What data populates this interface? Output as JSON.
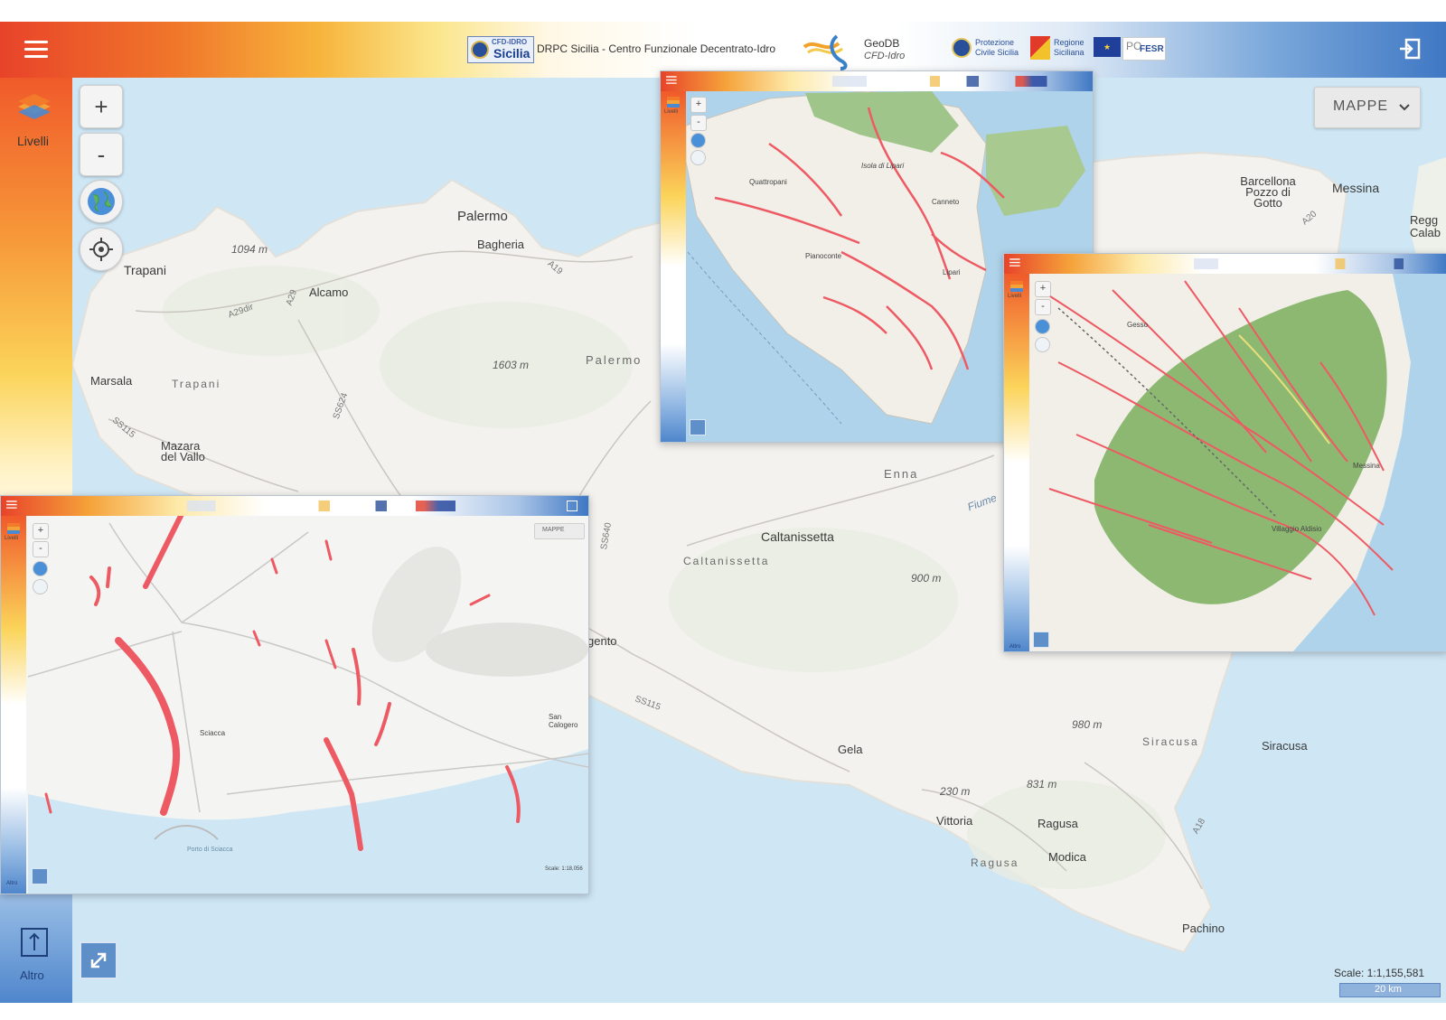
{
  "header": {
    "logo_cfd_top": "CFD-IDRO",
    "logo_cfd_bottom": "Sicilia",
    "title": "DRPC Sicilia - Centro Funzionale Decentrato-Idro",
    "geodb_title": "GeoDB",
    "geodb_sub": "CFD-Idro",
    "protezione_line1": "Protezione",
    "protezione_line2": "Civile Sicilia",
    "regione_line1": "Regione",
    "regione_line2": "Siciliana",
    "fesr_label": "FESR",
    "po_label": "PO"
  },
  "sidebar": {
    "layers_label": "Livelli",
    "altro_label": "Altro"
  },
  "controls": {
    "zoom_in": "+",
    "zoom_out": "-"
  },
  "maps_button": {
    "label": "MAPPE"
  },
  "scale": {
    "text": "Scale: 1:1,155,581",
    "bar_label": "20 km"
  },
  "map_labels": {
    "palermo": "Palermo",
    "palermo_province": "Palermo",
    "bagheria": "Bagheria",
    "trapani": "Trapani",
    "trapani_province": "Trapani",
    "alcamo": "Alcamo",
    "marsala": "Marsala",
    "mazara": "Mazara del Vallo",
    "barcellona": "Barcellona Pozzo di Gotto",
    "messina": "Messina",
    "reggio": "Regg Calab",
    "enna": "Enna",
    "caltanissetta": "Caltanissetta",
    "caltanissetta_province": "Caltanissetta",
    "gela": "Gela",
    "vittoria": "Vittoria",
    "ragusa": "Ragusa",
    "ragusa_province": "Ragusa",
    "modica": "Modica",
    "siracusa": "Siracusa",
    "siracusa_province": "Siracusa",
    "pachino": "Pachino",
    "agrigento_frag": "gento",
    "fiume": "Fiume",
    "elev_1094": "1094 m",
    "elev_1603": "1603 m",
    "elev_900": "900 m",
    "elev_980": "980 m",
    "elev_831": "831 m",
    "elev_230": "230 m",
    "road_a29": "A29",
    "road_a29dir": "A29dir",
    "road_a19": "A19",
    "road_a20": "A20",
    "road_a18": "A18",
    "road_ss115": "SS115",
    "road_ss115b": "SS115",
    "road_ss640": "SS640",
    "road_ss624": "SS624"
  },
  "inset_lipari": {
    "layers_label": "Livelli",
    "isola": "Isola di Lipari",
    "lipari": "Lipari",
    "canneto": "Canneto",
    "quattropani": "Quattropani",
    "pianoconte": "Pianoconte"
  },
  "inset_messina": {
    "layers_label": "Livelli",
    "messina": "Messina",
    "villaggio": "Villaggio Aldisio",
    "gesso": "Gesso",
    "altro_label": "Altro"
  },
  "inset_sciacca": {
    "layers_label": "Livelli",
    "maps_label": "MAPPE",
    "sciacca": "Sciacca",
    "san_calogero": "San Calogero",
    "porto": "Porto di Sciacca",
    "scale_text": "Scale: 1:18,056",
    "altro_label": "Altro"
  },
  "colors": {
    "sea": "#cfe7f5",
    "land": "#f3f2ee",
    "hazard_red": "#ee5a63",
    "forest": "#8db872",
    "header_orange": "#e8432a",
    "header_blue": "#3f78c4"
  },
  "icons": {
    "menu": "hamburger-menu-icon",
    "exit": "exit-icon",
    "layers": "layers-icon",
    "globe": "globe-icon",
    "locate": "crosshair-icon",
    "expand": "expand-icon",
    "more": "info-upload-icon"
  }
}
